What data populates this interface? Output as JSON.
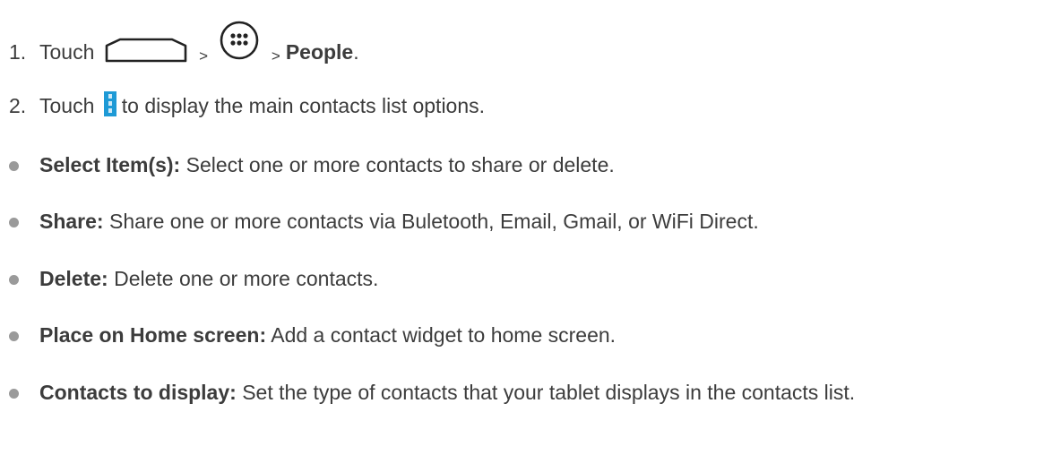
{
  "steps": [
    {
      "number": "1.",
      "prefix": "Touch",
      "separator1": ">",
      "separator2": ">",
      "target": "People",
      "suffix": ".",
      "icons": [
        "home-outline-icon",
        "apps-launcher-icon"
      ]
    },
    {
      "number": "2.",
      "prefix": "Touch",
      "suffix": "to display the main contacts list options.",
      "icons": [
        "menu-overflow-icon"
      ]
    }
  ],
  "options": [
    {
      "label": "Select Item(s):",
      "text": "Select one or more contacts to share or delete."
    },
    {
      "label": "Share:",
      "text": "Share one or more contacts via Buletooth, Email, Gmail, or WiFi Direct."
    },
    {
      "label": "Delete:",
      "text": "Delete one or more contacts."
    },
    {
      "label": "Place on Home screen:",
      "text": "Add a contact widget to home screen."
    },
    {
      "label": "Contacts to display:",
      "text": "Set the type of contacts that your tablet displays in the contacts list."
    }
  ],
  "colors": {
    "text": "#3c3c3c",
    "bullet": "#9a9a9a",
    "menu_icon_bg": "#1e9ad6"
  }
}
